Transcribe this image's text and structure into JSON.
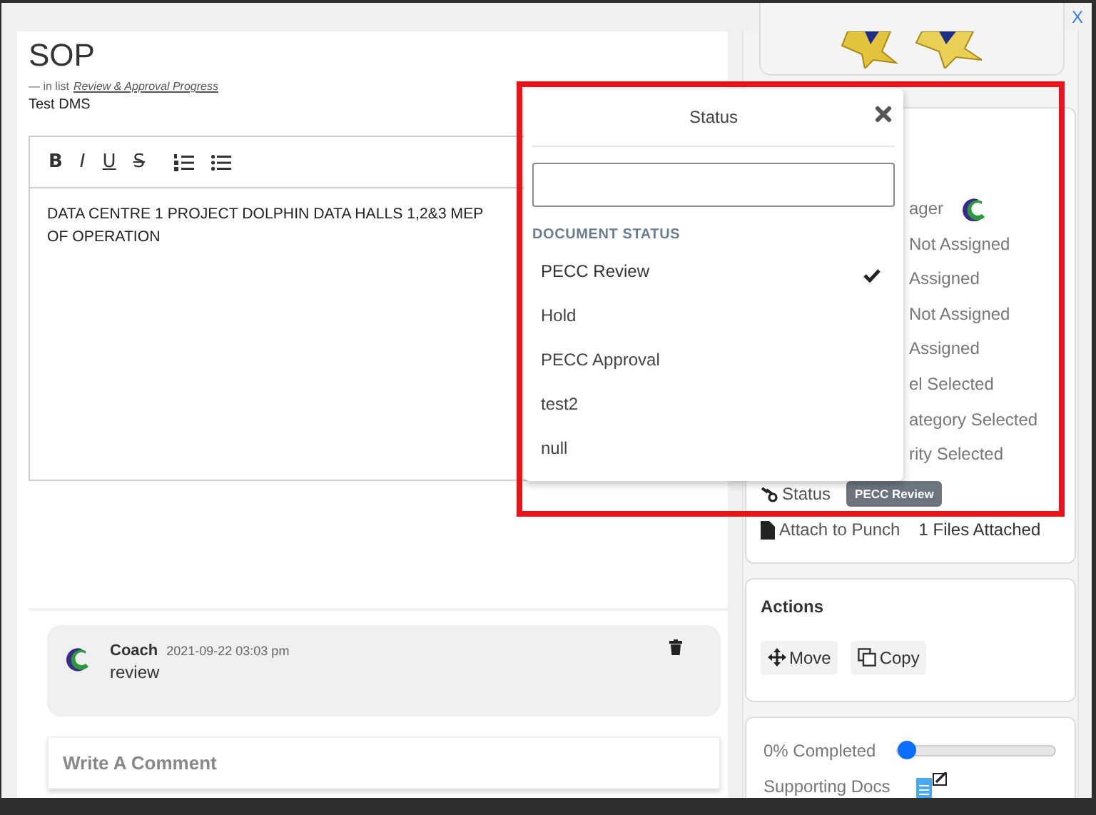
{
  "window": {
    "close": "X"
  },
  "document": {
    "title": "SOP",
    "list_prefix": "— in list",
    "list_link": "Review & Approval Progress",
    "project": "Test DMS"
  },
  "editor": {
    "toolbar": [
      {
        "kind": "bold",
        "label": "B"
      },
      {
        "kind": "italic",
        "label": "I"
      },
      {
        "kind": "underline",
        "label": "U"
      },
      {
        "kind": "strike",
        "label": "S"
      },
      {
        "kind": "ordered-list"
      },
      {
        "kind": "bullet-list"
      }
    ],
    "lines": [
      "DATA CENTRE 1 PROJECT DOLPHIN DATA HALLS 1,2&3 MEP",
      "OF OPERATION"
    ]
  },
  "comments": [
    {
      "author": "Coach",
      "time": "2021-09-22 03:03 pm",
      "text": "review"
    }
  ],
  "comment_box": {
    "placeholder": "Write A Comment"
  },
  "details": {
    "rows": [
      {
        "kind": "avatar",
        "value": "ager"
      },
      {
        "kind": "text",
        "value": "Not Assigned"
      },
      {
        "kind": "text",
        "value": "Assigned"
      },
      {
        "kind": "text",
        "value": "Not Assigned"
      },
      {
        "kind": "text",
        "value": "Assigned"
      },
      {
        "kind": "text",
        "value": "el Selected"
      },
      {
        "kind": "text",
        "value": "ategory Selected"
      },
      {
        "kind": "text",
        "value": "rity Selected"
      }
    ],
    "status": {
      "label": "Status",
      "badge": "PECC Review"
    },
    "attach": {
      "label": "Attach to Punch",
      "value": "1 Files Attached"
    }
  },
  "actions": {
    "title": "Actions",
    "buttons": [
      {
        "kind": "move",
        "label": "Move"
      },
      {
        "kind": "copy",
        "label": "Copy"
      }
    ]
  },
  "progress": {
    "label": "0% Completed",
    "level": 0,
    "docs_label": "Supporting Docs"
  },
  "status_popup": {
    "title": "Status",
    "section": "DOCUMENT STATUS",
    "options": [
      {
        "label": "PECC Review",
        "selected": true
      },
      {
        "label": "Hold",
        "selected": false
      },
      {
        "label": "PECC Approval",
        "selected": false
      },
      {
        "label": "test2",
        "selected": false
      },
      {
        "label": "null",
        "selected": false
      }
    ]
  },
  "annotation": {
    "kind": "highlight"
  }
}
